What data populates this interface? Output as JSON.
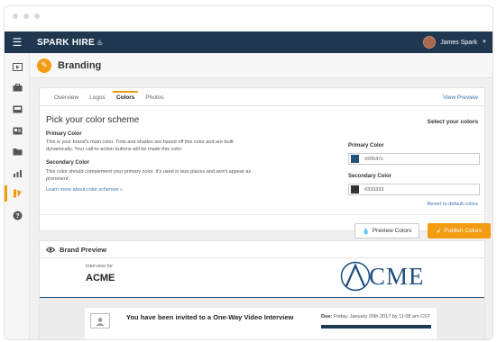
{
  "app": {
    "logo": "SPARK HIRE",
    "user_name": "James Spark"
  },
  "page": {
    "title": "Branding"
  },
  "tabs": [
    {
      "label": "Overview",
      "active": false
    },
    {
      "label": "Logos",
      "active": false
    },
    {
      "label": "Colors",
      "active": true
    },
    {
      "label": "Photos",
      "active": false
    }
  ],
  "view_preview": "View Preview",
  "scheme": {
    "title": "Pick your color scheme",
    "select_label": "Select your colors",
    "primary_heading": "Primary Color",
    "primary_desc_1": "This is your brand's main color. Tints and shades are based off this color and are built",
    "primary_desc_2": "dynamically. Your call-to-action buttons will be made this color.",
    "secondary_heading": "Secondary Color",
    "secondary_desc_1": "This color should complement your primary color. It's used in less places and won't appear as",
    "secondary_desc_2": "prominent.",
    "learn_more": "Learn more about color schemes »",
    "primary_field_label": "Primary Color",
    "primary_value": "#20547c",
    "secondary_field_label": "Secondary Color",
    "secondary_value": "#333333",
    "revert": "Revert to default colors"
  },
  "actions": {
    "preview": "Preview Colors",
    "publish": "Publish Colors"
  },
  "brand_preview": {
    "title": "Brand Preview",
    "interview_for": "Interview for:",
    "company": "ACME",
    "logo_text": "CME",
    "invite_title": "You have been invited to a One-Way Video Interview",
    "due_label": "Due:",
    "due_value": "Friday, January 20th 2017 by 11:08 am CST"
  },
  "colors": {
    "accent": "#f39c12",
    "topbar": "#1f3850",
    "primary": "#20547c",
    "secondary": "#333333",
    "link": "#3a75b0"
  }
}
